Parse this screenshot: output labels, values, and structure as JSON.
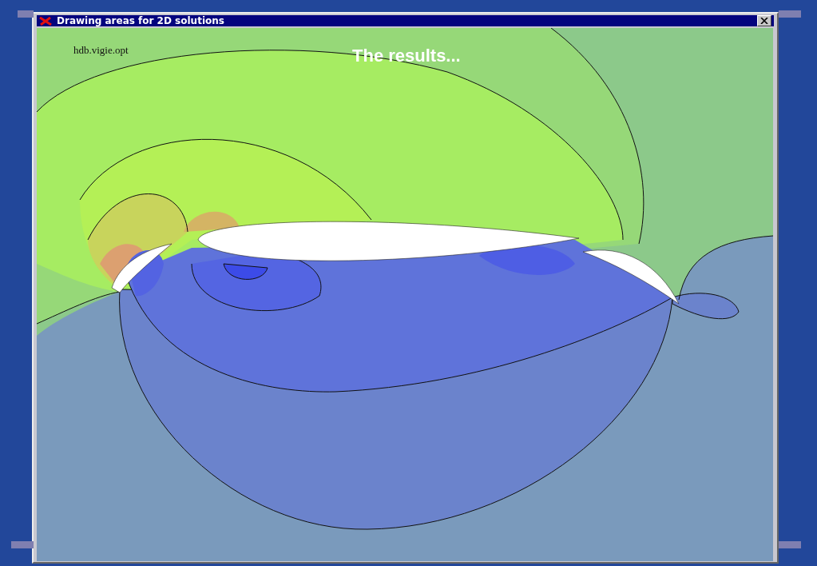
{
  "slide": {
    "title": "The results..."
  },
  "window": {
    "title": "Drawing areas for 2D solutions"
  },
  "plot": {
    "file_label": "hdb.vigie.opt"
  }
}
